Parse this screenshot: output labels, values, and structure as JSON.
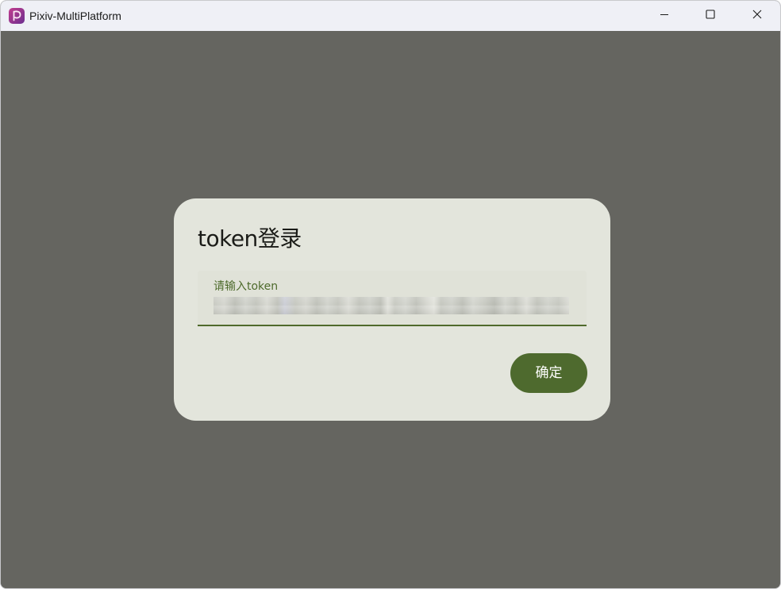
{
  "window": {
    "title": "Pixiv-MultiPlatform",
    "app_icon": "pixiv-logo-icon",
    "controls": [
      "minimize-icon",
      "maximize-icon",
      "close-icon"
    ]
  },
  "dialog": {
    "title": "token登录",
    "field": {
      "label": "请输入token",
      "value": "••••••••••••••••••••••••••••••••••••••••••••",
      "value_obscured": true
    },
    "confirm_label": "确定"
  },
  "colors": {
    "titlebar": "#eff0f6",
    "backdrop": "#656560",
    "dialog_bg": "#e3e5dc",
    "field_bg": "#e0e2d8",
    "accent": "#4e6a2e",
    "icon_brand": "#9b2f8a"
  }
}
